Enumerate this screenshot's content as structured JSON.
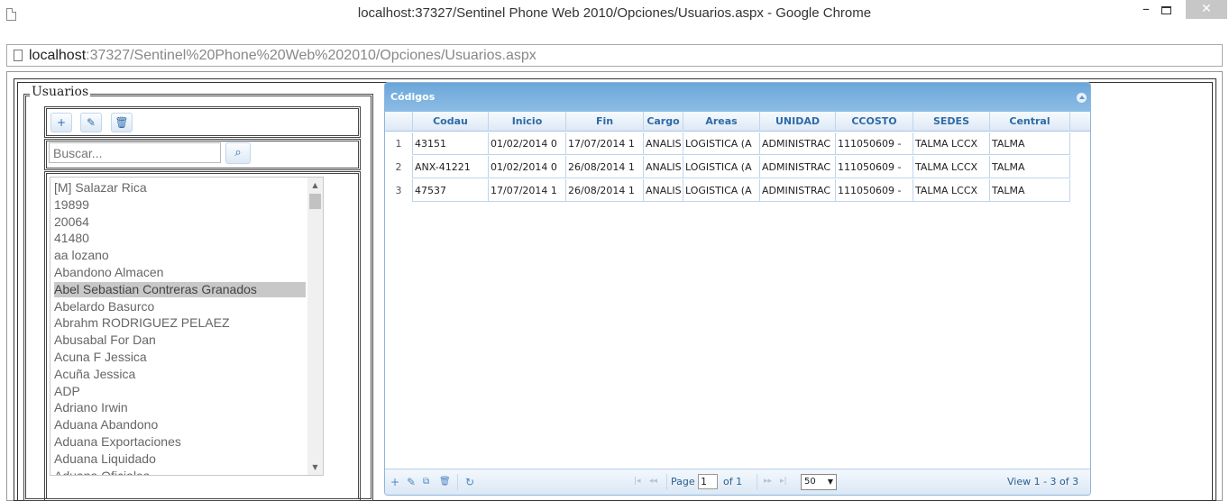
{
  "window": {
    "title": "localhost:37327/Sentinel Phone Web 2010/Opciones/Usuarios.aspx - Google Chrome",
    "minimize": "–",
    "close": "✕"
  },
  "address": {
    "host": "localhost",
    "rest": ":37327/Sentinel%20Phone%20Web%202010/Opciones/Usuarios.aspx"
  },
  "usuarios": {
    "legend": "Usuarios",
    "toolbar": {
      "add": "+",
      "edit": "✎",
      "delete": "🗑"
    },
    "search": {
      "placeholder": "Buscar...",
      "button": "⌕"
    },
    "items": [
      "[M] Salazar Rica",
      "19899",
      "20064",
      "41480",
      "aa lozano",
      "Abandono Almacen",
      "Abel Sebastian Contreras Granados",
      "Abelardo Basurco",
      "Abrahm RODRIGUEZ PELAEZ",
      "Abusabal For Dan",
      "Acuna F Jessica",
      "Acuña Jessica",
      "ADP",
      "Adriano Irwin",
      "Aduana Abandono",
      "Aduana Exportaciones",
      "Aduana Liquidado",
      "Aduana Oficiales"
    ],
    "selected_index": 6
  },
  "grid": {
    "title": "Códigos",
    "columns": [
      "",
      "Codau",
      "Inicio",
      "Fin",
      "Cargo",
      "Areas",
      "UNIDAD",
      "CCOSTO",
      "SEDES",
      "Central"
    ],
    "rows": [
      [
        "1",
        "43151",
        "01/02/2014 0",
        "17/07/2014 1",
        "ANALIS",
        "LOGISTICA (A",
        "ADMINISTRAC",
        "111050609 -",
        "TALMA LCCX",
        "TALMA"
      ],
      [
        "2",
        "ANX-41221",
        "01/02/2014 0",
        "26/08/2014 1",
        "ANALIS",
        "LOGISTICA (A",
        "ADMINISTRAC",
        "111050609 -",
        "TALMA LCCX",
        "TALMA"
      ],
      [
        "3",
        "47537",
        "17/07/2014 1",
        "26/08/2014 1",
        "ANALIS",
        "LOGISTICA (A",
        "ADMINISTRAC",
        "111050609 -",
        "TALMA LCCX",
        "TALMA"
      ]
    ],
    "pager": {
      "page_label": "Page",
      "page_value": "1",
      "of_label": "of 1",
      "rows_per_page": "50",
      "view_text": "View 1 - 3 of 3"
    }
  },
  "colors": {
    "header_blue": "#6ba6d9",
    "accent_text": "#2e6aa6",
    "selected_row": "#c8c8c8"
  }
}
